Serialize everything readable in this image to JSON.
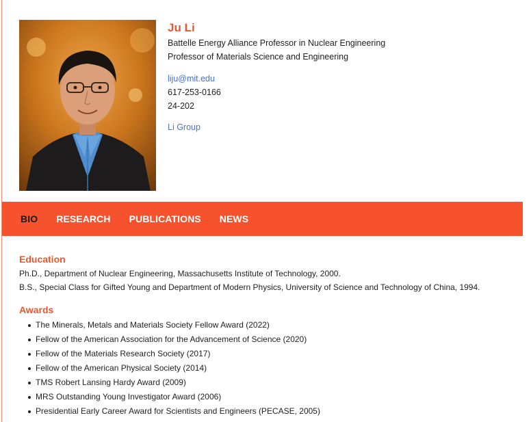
{
  "profile": {
    "name": "Ju Li",
    "titles": [
      "Battelle Energy Alliance Professor in Nuclear Engineering",
      "Professor of Materials Science and Engineering"
    ],
    "email": "liju@mit.edu",
    "phone": "617-253-0166",
    "office": "24-202",
    "group_link": "Li Group"
  },
  "nav": {
    "items": [
      "BIO",
      "RESEARCH",
      "PUBLICATIONS",
      "NEWS"
    ],
    "active": "BIO"
  },
  "education": {
    "heading": "Education",
    "entries": [
      "Ph.D., Department of Nuclear Engineering, Massachusetts Institute of Technology, 2000.",
      "B.S., Special Class for Gifted Young and Department of Modern Physics, University of Science and Technology of China, 1994."
    ]
  },
  "awards": {
    "heading": "Awards",
    "items": [
      "The Minerals, Metals and Materials Society Fellow Award (2022)",
      "Fellow of the American Association for the Advancement of Science (2020)",
      "Fellow of the Materials Research Society (2017)",
      "Fellow of the American Physical Society (2014)",
      "TMS Robert Lansing Hardy Award (2009)",
      "MRS Outstanding Young Investigator Award (2006)",
      "Presidential Early Career Award for Scientists and Engineers (PECASE, 2005)"
    ]
  },
  "colors": {
    "accent": "#e8582e",
    "nav_background": "#f5522d",
    "link": "#4a72c4"
  }
}
